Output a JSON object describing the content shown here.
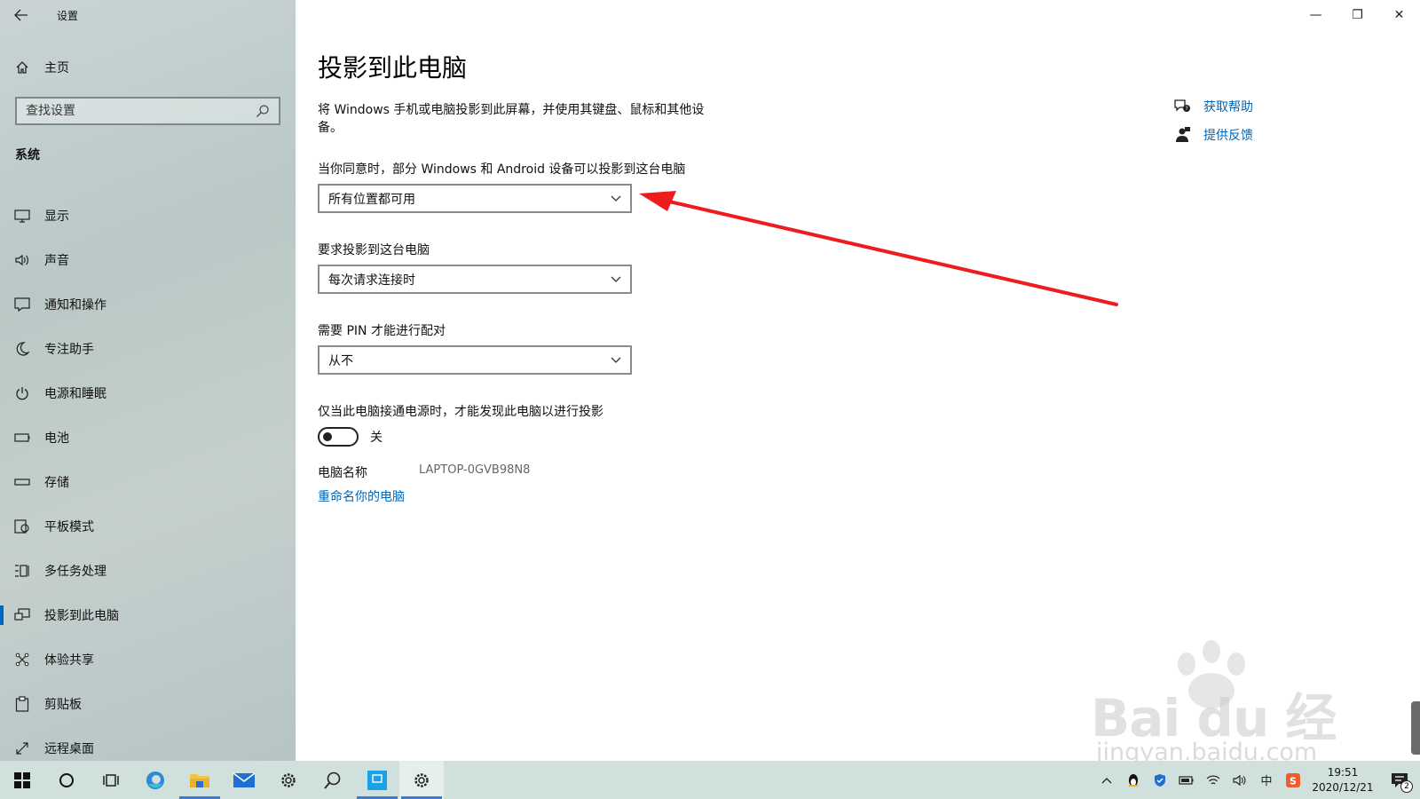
{
  "window": {
    "title": "设置",
    "controls": {
      "minimize": "—",
      "restore": "❐",
      "close": "✕"
    }
  },
  "sidebar": {
    "home_label": "主页",
    "search_placeholder": "查找设置",
    "section_title": "系统",
    "items": [
      {
        "label": "显示",
        "icon": "monitor-icon"
      },
      {
        "label": "声音",
        "icon": "speaker-icon"
      },
      {
        "label": "通知和操作",
        "icon": "notification-icon"
      },
      {
        "label": "专注助手",
        "icon": "moon-icon"
      },
      {
        "label": "电源和睡眠",
        "icon": "power-icon"
      },
      {
        "label": "电池",
        "icon": "battery-icon"
      },
      {
        "label": "存储",
        "icon": "storage-icon"
      },
      {
        "label": "平板模式",
        "icon": "tablet-mode-icon"
      },
      {
        "label": "多任务处理",
        "icon": "multitask-icon"
      },
      {
        "label": "投影到此电脑",
        "icon": "project-icon",
        "active": true
      },
      {
        "label": "体验共享",
        "icon": "share-icon"
      },
      {
        "label": "剪贴板",
        "icon": "clipboard-icon"
      },
      {
        "label": "远程桌面",
        "icon": "remote-desktop-icon"
      }
    ]
  },
  "main": {
    "title": "投影到此电脑",
    "description": "将 Windows 手机或电脑投影到此屏幕，并使用其键盘、鼠标和其他设备。",
    "setting1": {
      "label": "当你同意时，部分 Windows 和 Android 设备可以投影到这台电脑",
      "value": "所有位置都可用"
    },
    "setting2": {
      "label": "要求投影到这台电脑",
      "value": "每次请求连接时"
    },
    "setting3": {
      "label": "需要 PIN 才能进行配对",
      "value": "从不"
    },
    "setting4": {
      "label": "仅当此电脑接通电源时，才能发现此电脑以进行投影",
      "toggle_state": "关",
      "toggle_on": false
    },
    "pc_name": {
      "label": "电脑名称",
      "value": "LAPTOP-0GVB98N8"
    },
    "rename_link": "重命名你的电脑"
  },
  "help": {
    "get_help": "获取帮助",
    "feedback": "提供反馈"
  },
  "watermark": {
    "main": "Bai du 经验",
    "sub": "jingyan.baidu.com"
  },
  "taskbar": {
    "clock_time": "19:51",
    "clock_date": "2020/12/21",
    "ime": "中",
    "notification_count": "2"
  },
  "colors": {
    "accent": "#0067b8",
    "annotation_arrow": "#ee1c1c",
    "taskbar": "#cfe0dd"
  }
}
